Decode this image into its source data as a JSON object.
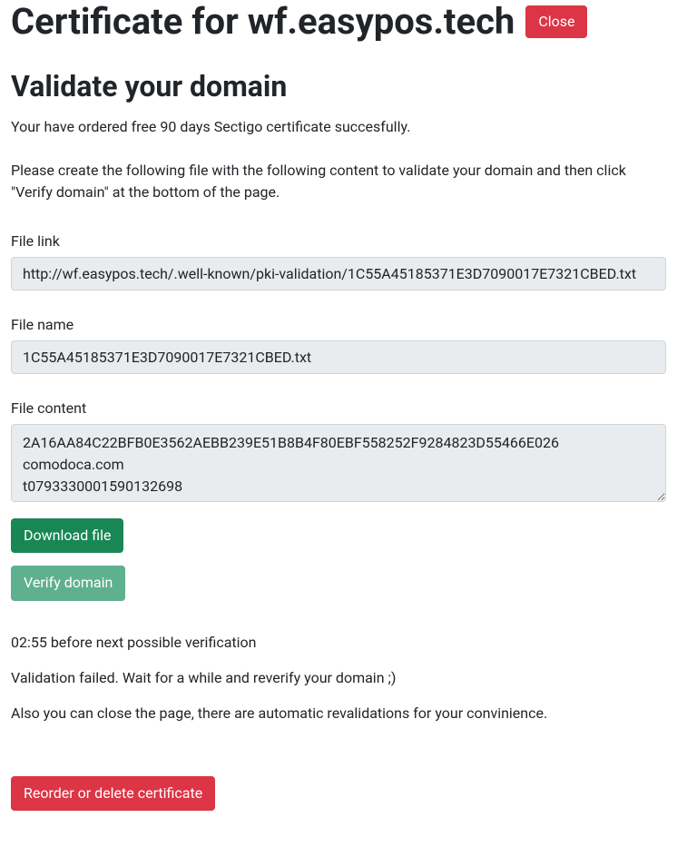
{
  "header": {
    "title": "Certificate for wf.easypos.tech",
    "close_label": "Close"
  },
  "subtitle": "Validate your domain",
  "intro": "Your have ordered free 90 days Sectigo certificate succesfully.",
  "instruction": "Please create the following file with the following content to validate your domain and then click \"Verify domain\" at the bottom of the page.",
  "fields": {
    "file_link": {
      "label": "File link",
      "value": "http://wf.easypos.tech/.well-known/pki-validation/1C55A45185371E3D7090017E7321CBED.txt"
    },
    "file_name": {
      "label": "File name",
      "value": "1C55A45185371E3D7090017E7321CBED.txt"
    },
    "file_content": {
      "label": "File content",
      "value": "2A16AA84C22BFB0E3562AEBB239E51B8B4F80EBF558252F9284823D55466E026\ncomodoca.com\nt0793330001590132698"
    }
  },
  "buttons": {
    "download_label": "Download file",
    "verify_label": "Verify domain",
    "reorder_label": "Reorder or delete certificate"
  },
  "timer": "02:55 before next possible verification",
  "validation_status": "Validation failed. Wait for a while and reverify your domain ;)",
  "auto_info": "Also you can close the page, there are automatic revalidations for your convinience."
}
